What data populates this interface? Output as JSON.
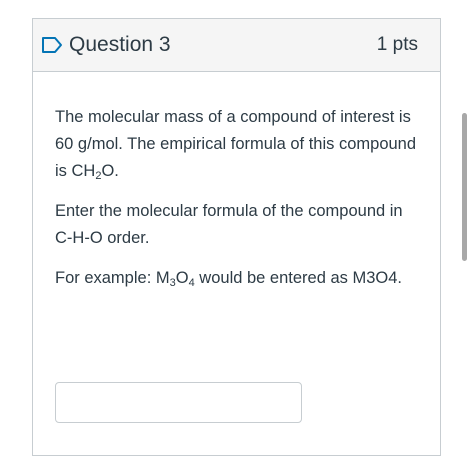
{
  "question": {
    "title": "Question 3",
    "points": "1 pts",
    "flag_icon": "flag-outline-icon",
    "paragraph1": {
      "part1": "The molecular mass of a compound of interest is 60 g/mol. The empirical formula of this compound is CH",
      "sub": "2",
      "part2": "O."
    },
    "paragraph2": "Enter the molecular formula of the compound in C-H-O order.",
    "paragraph3": {
      "part1": "For example: M",
      "sub1": "3",
      "part2": "O",
      "sub2": "4",
      "part3": " would be entered as M3O4."
    },
    "answer": {
      "value": "",
      "placeholder": ""
    }
  },
  "colors": {
    "accent": "#0374b5",
    "text": "#2d3b45",
    "border": "#c7cdd1",
    "header_bg": "#f5f5f5"
  }
}
